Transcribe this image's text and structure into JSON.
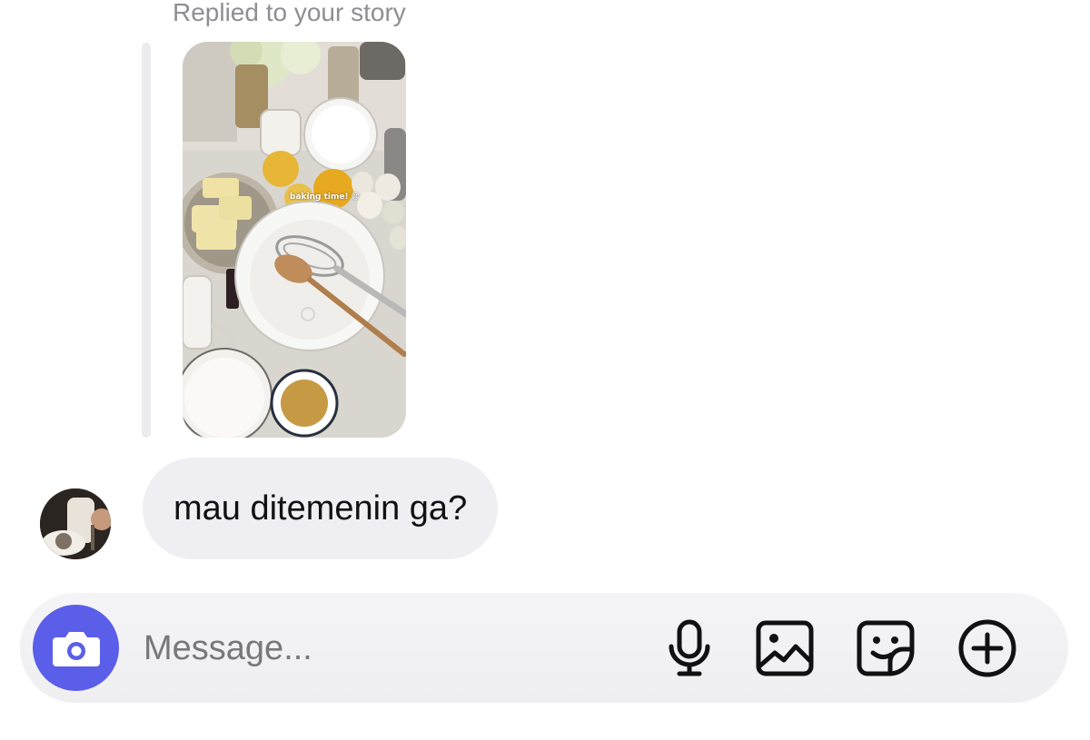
{
  "conversation": {
    "reply_context": "Replied to your story",
    "story": {
      "caption": "baking time! ☺",
      "image": "story-image"
    },
    "message": {
      "text": "mau ditemenin ga?",
      "avatar": "avatar"
    }
  },
  "composer": {
    "placeholder": "Message...",
    "buttons": [
      {
        "name": "camera",
        "icon": "camera-icon",
        "color": "#5a5ee8"
      },
      {
        "name": "voice",
        "icon": "microphone-icon"
      },
      {
        "name": "gallery",
        "icon": "image-icon"
      },
      {
        "name": "sticker",
        "icon": "sticker-icon"
      },
      {
        "name": "more",
        "icon": "plus-circle-icon"
      }
    ]
  }
}
